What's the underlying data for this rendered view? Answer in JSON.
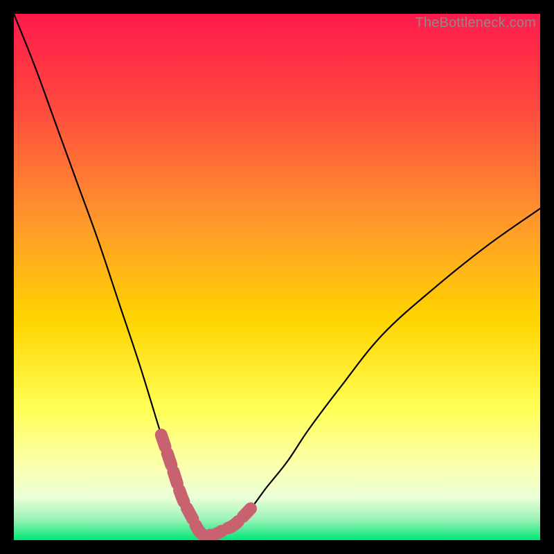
{
  "watermark": "TheBottleneck.com",
  "colors": {
    "background_black": "#000000",
    "gradient_top": "#ff1a4c",
    "gradient_mid_upper": "#ff7a2a",
    "gradient_mid": "#ffd400",
    "gradient_lower": "#ffff66",
    "gradient_near_bottom": "#f8ffd0",
    "gradient_bottom": "#00e676",
    "curve_stroke": "#000000",
    "pink_band": "#c96270"
  },
  "chart_data": {
    "type": "line",
    "title": "",
    "xlabel": "",
    "ylabel": "",
    "xlim": [
      0,
      100
    ],
    "ylim": [
      0,
      100
    ],
    "series": [
      {
        "name": "bottleneck-curve",
        "x": [
          0,
          4,
          8,
          12,
          16,
          20,
          24,
          28,
          30,
          32,
          34,
          35,
          36,
          37,
          38,
          40,
          42,
          45,
          48,
          52,
          56,
          62,
          70,
          80,
          90,
          100
        ],
        "y": [
          100,
          90,
          79,
          68,
          57,
          45,
          33,
          20,
          14,
          8,
          4,
          2,
          1,
          1,
          1,
          2,
          3,
          6,
          10,
          15,
          21,
          29,
          39,
          48,
          56,
          63
        ]
      }
    ],
    "annotations": [
      {
        "name": "pink-bottom-band",
        "type": "segment-overlay",
        "x_range": [
          27,
          45
        ],
        "y_approx": 2,
        "note": "thick pink overlay tracing the bottom of the V"
      }
    ]
  }
}
